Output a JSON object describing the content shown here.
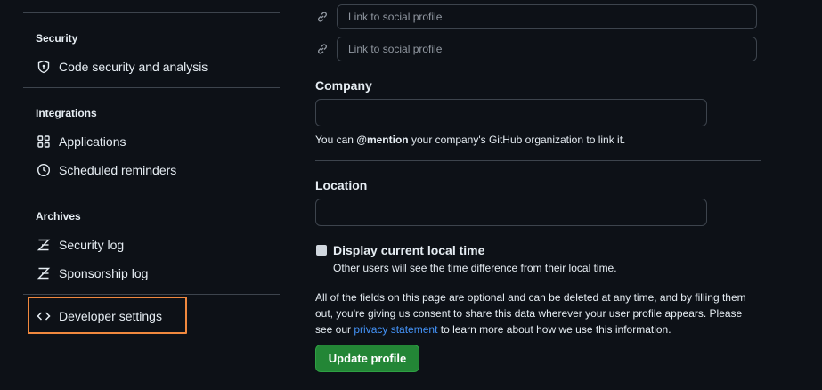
{
  "sidebar": {
    "sections": [
      {
        "title": "Security",
        "items": [
          {
            "label": "Code security and analysis",
            "icon": "shield-lock-icon"
          }
        ]
      },
      {
        "title": "Integrations",
        "items": [
          {
            "label": "Applications",
            "icon": "apps-grid-icon"
          },
          {
            "label": "Scheduled reminders",
            "icon": "clock-icon"
          }
        ]
      },
      {
        "title": "Archives",
        "items": [
          {
            "label": "Security log",
            "icon": "log-icon"
          },
          {
            "label": "Sponsorship log",
            "icon": "log-icon"
          }
        ]
      }
    ],
    "developer": {
      "label": "Developer settings",
      "icon": "code-icon"
    },
    "highlight_color": "#f0883e"
  },
  "profile": {
    "social": [
      {
        "placeholder": "Link to social profile",
        "value": ""
      },
      {
        "placeholder": "Link to social profile",
        "value": ""
      }
    ],
    "company": {
      "label": "Company",
      "value": "",
      "note_prefix": "You can ",
      "note_mention": "@mention",
      "note_suffix": " your company's GitHub organization to link it."
    },
    "location": {
      "label": "Location",
      "value": ""
    },
    "local_time": {
      "label": "Display current local time",
      "note": "Other users will see the time difference from their local time.",
      "checked": false
    },
    "disclaimer": {
      "text_before": "All of the fields on this page are optional and can be deleted at any time, and by filling them out, you're giving us consent to share this data wherever your user profile appears. Please see our ",
      "link": "privacy statement",
      "text_after": " to learn more about how we use this information."
    },
    "update_button": "Update profile",
    "button_color": "#238636"
  }
}
